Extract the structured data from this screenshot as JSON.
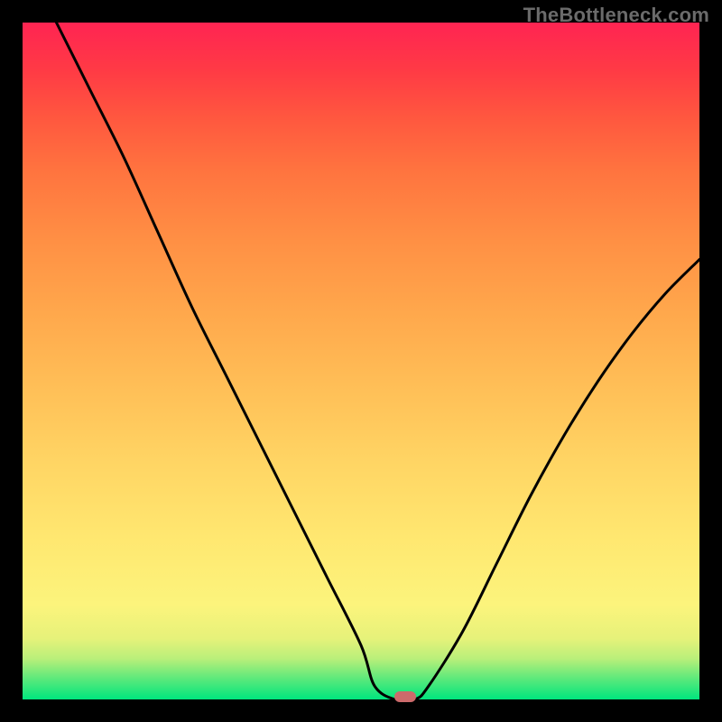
{
  "watermark": "TheBottleneck.com",
  "chart_data": {
    "type": "line",
    "title": "",
    "xlabel": "",
    "ylabel": "",
    "xlim": [
      0,
      100
    ],
    "ylim": [
      0,
      100
    ],
    "grid": false,
    "legend": false,
    "background_gradient": {
      "stops": [
        {
          "pos": 0,
          "color": "#00e57e"
        },
        {
          "pos": 3,
          "color": "#5ae97b"
        },
        {
          "pos": 6,
          "color": "#b9ef7a"
        },
        {
          "pos": 9,
          "color": "#e6f27a"
        },
        {
          "pos": 14,
          "color": "#fcf47c"
        },
        {
          "pos": 24,
          "color": "#ffe770"
        },
        {
          "pos": 35,
          "color": "#ffd564"
        },
        {
          "pos": 46,
          "color": "#ffbf57"
        },
        {
          "pos": 57,
          "color": "#ffa84c"
        },
        {
          "pos": 68,
          "color": "#ff8f44"
        },
        {
          "pos": 78,
          "color": "#ff743f"
        },
        {
          "pos": 86,
          "color": "#ff573f"
        },
        {
          "pos": 93,
          "color": "#ff3a45"
        },
        {
          "pos": 100,
          "color": "#ff2452"
        }
      ]
    },
    "series": [
      {
        "name": "bottleneck-curve",
        "color": "#000000",
        "x": [
          5,
          10,
          15,
          20,
          25,
          30,
          35,
          40,
          45,
          50,
          52,
          55,
          58,
          60,
          65,
          70,
          75,
          80,
          85,
          90,
          95,
          100
        ],
        "y": [
          100,
          90,
          80,
          69,
          58,
          48,
          38,
          28,
          18,
          8,
          2,
          0,
          0,
          2,
          10,
          20,
          30,
          39,
          47,
          54,
          60,
          65
        ]
      }
    ],
    "marker": {
      "x": 56.5,
      "y": 0,
      "color": "#cc6a6b"
    }
  }
}
